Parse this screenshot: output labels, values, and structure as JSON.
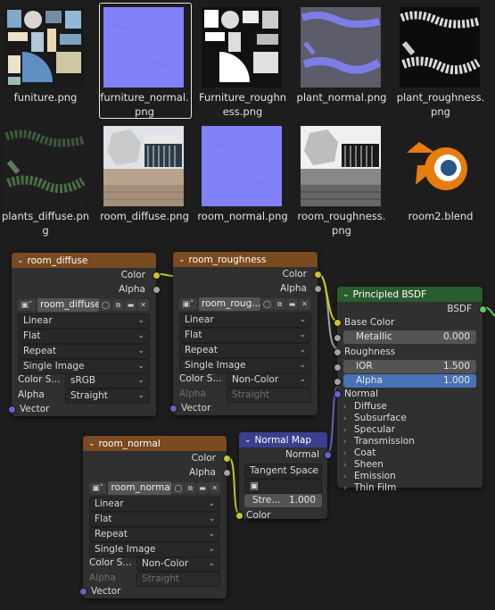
{
  "files": [
    {
      "label": "funiture.png",
      "kind": "atlas"
    },
    {
      "label": "furniture_normal.png",
      "kind": "normal",
      "selected": true
    },
    {
      "label": "Furniture_roughness.png",
      "kind": "rough"
    },
    {
      "label": "plant_normal.png",
      "kind": "plantnormal"
    },
    {
      "label": "plant_roughness.png",
      "kind": "plantrough"
    },
    {
      "label": "plants_diffuse.png",
      "kind": "plantdiffuse"
    },
    {
      "label": "room_diffuse.png",
      "kind": "room"
    },
    {
      "label": "room_normal.png",
      "kind": "normal"
    },
    {
      "label": "room_roughness.png",
      "kind": "roomrough"
    },
    {
      "label": "room2.blend",
      "kind": "blend"
    }
  ],
  "nodes": {
    "room_diffuse": {
      "title": "room_diffuse",
      "out_color": "Color",
      "out_alpha": "Alpha",
      "image": "room_diffuse",
      "interpolation": "Linear",
      "projection": "Flat",
      "extension": "Repeat",
      "source": "Single Image",
      "color_space_label": "Color S...",
      "color_space": "sRGB",
      "alpha_label": "Alpha",
      "alpha_mode": "Straight",
      "in_vector": "Vector"
    },
    "room_roughness": {
      "title": "room_roughness",
      "out_color": "Color",
      "out_alpha": "Alpha",
      "image": "room_roug...",
      "interpolation": "Linear",
      "projection": "Flat",
      "extension": "Repeat",
      "source": "Single Image",
      "color_space_label": "Color S...",
      "color_space": "Non-Color",
      "alpha_label": "Alpha",
      "alpha_mode": "Straight",
      "in_vector": "Vector"
    },
    "room_normal": {
      "title": "room_normal",
      "out_color": "Color",
      "out_alpha": "Alpha",
      "image": "room_normal",
      "interpolation": "Linear",
      "projection": "Flat",
      "extension": "Repeat",
      "source": "Single Image",
      "color_space_label": "Color S...",
      "color_space": "Non-Color",
      "alpha_label": "Alpha",
      "alpha_mode": "Straight",
      "in_vector": "Vector"
    },
    "normal_map": {
      "title": "Normal Map",
      "out_normal": "Normal",
      "space": "Tangent Space",
      "strength_label": "Stre...",
      "strength": "1.000",
      "in_color": "Color"
    },
    "bsdf": {
      "title": "Principled BSDF",
      "out_bsdf": "BSDF",
      "base_color": "Base Color",
      "metallic_label": "Metallic",
      "metallic": "0.000",
      "roughness": "Roughness",
      "ior_label": "IOR",
      "ior": "1.500",
      "alpha_label": "Alpha",
      "alpha": "1.000",
      "normal": "Normal",
      "panels": [
        "Diffuse",
        "Subsurface",
        "Specular",
        "Transmission",
        "Coat",
        "Sheen",
        "Emission",
        "Thin Film"
      ]
    }
  }
}
